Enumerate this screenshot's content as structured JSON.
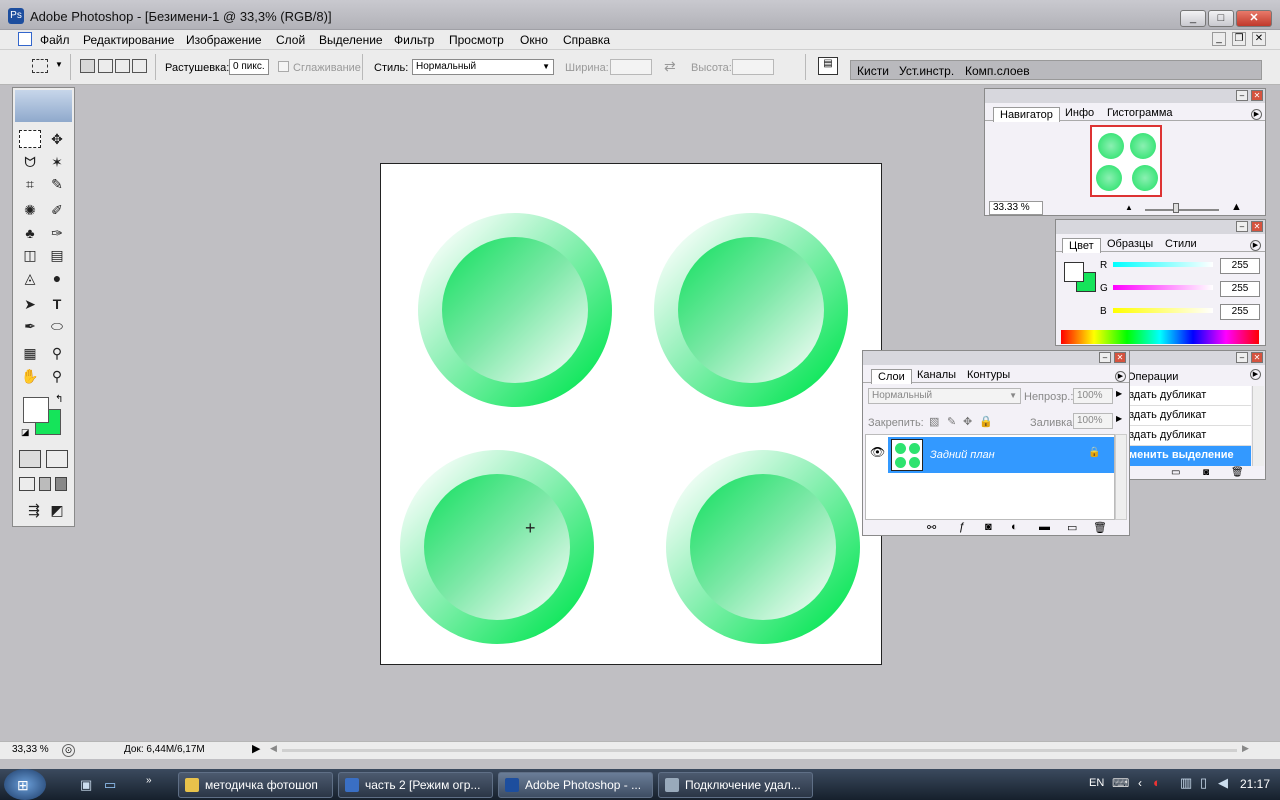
{
  "window": {
    "title": "Adobe Photoshop - [Безимени-1 @ 33,3% (RGB/8)]",
    "min": "_",
    "max": "□",
    "close": "✕"
  },
  "menu": [
    "Файл",
    "Редактирование",
    "Изображение",
    "Слой",
    "Выделение",
    "Фильтр",
    "Просмотр",
    "Окно",
    "Справка"
  ],
  "options": {
    "feather_label": "Растушевка:",
    "feather_value": "0 пикс.",
    "smooth_label": "Сглаживание",
    "style_label": "Стиль:",
    "style_value": "Нормальный",
    "width_label": "Ширина:",
    "height_label": "Высота:",
    "well_tabs": [
      "Кисти",
      "Уст.инстр.",
      "Комп.слоев"
    ]
  },
  "navigator": {
    "tabs": [
      "Навигатор",
      "Инфо",
      "Гистограмма"
    ],
    "zoom": "33.33 %"
  },
  "color": {
    "tabs": [
      "Цвет",
      "Образцы",
      "Стили"
    ],
    "channels": [
      {
        "name": "R",
        "value": "255"
      },
      {
        "name": "G",
        "value": "255"
      },
      {
        "name": "B",
        "value": "255"
      }
    ],
    "fg": "#ffffff",
    "bg": "#15e45a"
  },
  "layers": {
    "tabs": [
      "Слои",
      "Каналы",
      "Контуры"
    ],
    "mode": "Нормальный",
    "opacity_label": "Непрозр.:",
    "opacity": "100%",
    "lock_label": "Закрепить:",
    "fill_label": "Заливка:",
    "fill": "100%",
    "layer_name": "Задний план"
  },
  "history": {
    "tab": "Операции",
    "items": [
      "здать дубликат",
      "здать дубликат",
      "здать дубликат",
      "менить выделение"
    ]
  },
  "status": {
    "zoom": "33,33 %",
    "doc": "Док: 6,44M/6,17M"
  },
  "taskbar": {
    "items": [
      "методичка фотошоп",
      "часть 2 [Режим огр...",
      "Adobe Photoshop - ...",
      "Подключение удал..."
    ],
    "lang": "EN",
    "time": "21:17"
  },
  "colors": {
    "accent": "#3399ff",
    "green": "#15e45a"
  }
}
